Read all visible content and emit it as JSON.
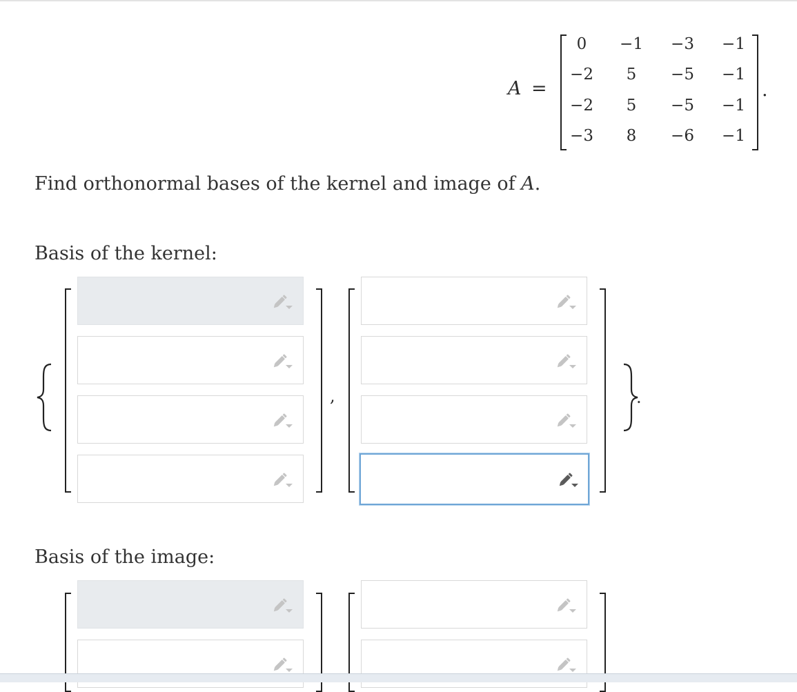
{
  "matrix": {
    "label": "A",
    "equals": "=",
    "rows": [
      [
        "0",
        "−1",
        "−3",
        "−1"
      ],
      [
        "−2",
        "5",
        "−5",
        "−1"
      ],
      [
        "−2",
        "5",
        "−5",
        "−1"
      ],
      [
        "−3",
        "8",
        "−6",
        "−1"
      ]
    ],
    "period": "."
  },
  "prompt": {
    "text": "Find orthonormal bases of the kernel and image of ",
    "var": "A",
    "end": "."
  },
  "kernel": {
    "title": "Basis of the kernel:",
    "separator": ",",
    "closing_period": ".",
    "vectors": [
      {
        "entries": [
          "",
          "",
          "",
          ""
        ]
      },
      {
        "entries": [
          "",
          "",
          "",
          ""
        ]
      }
    ]
  },
  "image": {
    "title": "Basis of the image:",
    "vectors": [
      {
        "entries": [
          "",
          ""
        ]
      },
      {
        "entries": [
          "",
          ""
        ]
      }
    ]
  },
  "icons": {
    "input_tool": "pencil-dropdown-icon"
  },
  "colors": {
    "shaded_input": "#e8ebee",
    "focus_border": "#6fa6d6",
    "pencil_inactive": "#c4c4c4",
    "pencil_active": "#5a5a5a"
  }
}
